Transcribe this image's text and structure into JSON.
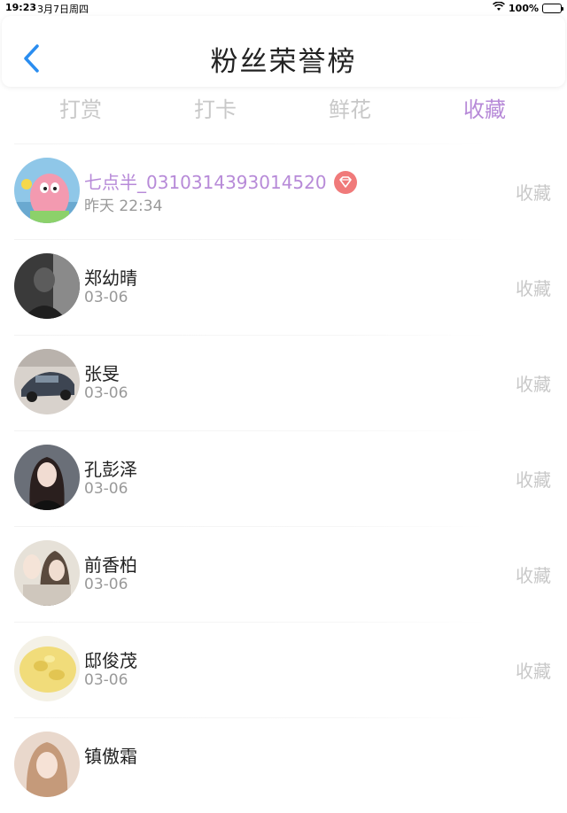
{
  "status_bar": {
    "time": "19:23",
    "date": "3月7日周四",
    "battery": "100%"
  },
  "header": {
    "title": "粉丝荣誉榜"
  },
  "tabs": [
    {
      "label": "打赏",
      "active": false
    },
    {
      "label": "打卡",
      "active": false
    },
    {
      "label": "鲜花",
      "active": false
    },
    {
      "label": "收藏",
      "active": true
    }
  ],
  "fans": [
    {
      "name": "七点半_0310314393014520",
      "time": "昨天 22:34",
      "action": "收藏",
      "vip": true
    },
    {
      "name": "郑幼晴",
      "time": "03-06",
      "action": "收藏",
      "vip": false
    },
    {
      "name": "张旻",
      "time": "03-06",
      "action": "收藏",
      "vip": false
    },
    {
      "name": "孔彭泽",
      "time": "03-06",
      "action": "收藏",
      "vip": false
    },
    {
      "name": "前香柏",
      "time": "03-06",
      "action": "收藏",
      "vip": false
    },
    {
      "name": "邸俊茂",
      "time": "03-06",
      "action": "收藏",
      "vip": false
    },
    {
      "name": "镇傲霜",
      "time": "",
      "action": "",
      "vip": false
    }
  ],
  "colors": {
    "accent": "#b78ad8",
    "back_arrow": "#2a8df0",
    "vip_badge": "#f07a7a",
    "inactive_tab": "#c8c8c8"
  }
}
